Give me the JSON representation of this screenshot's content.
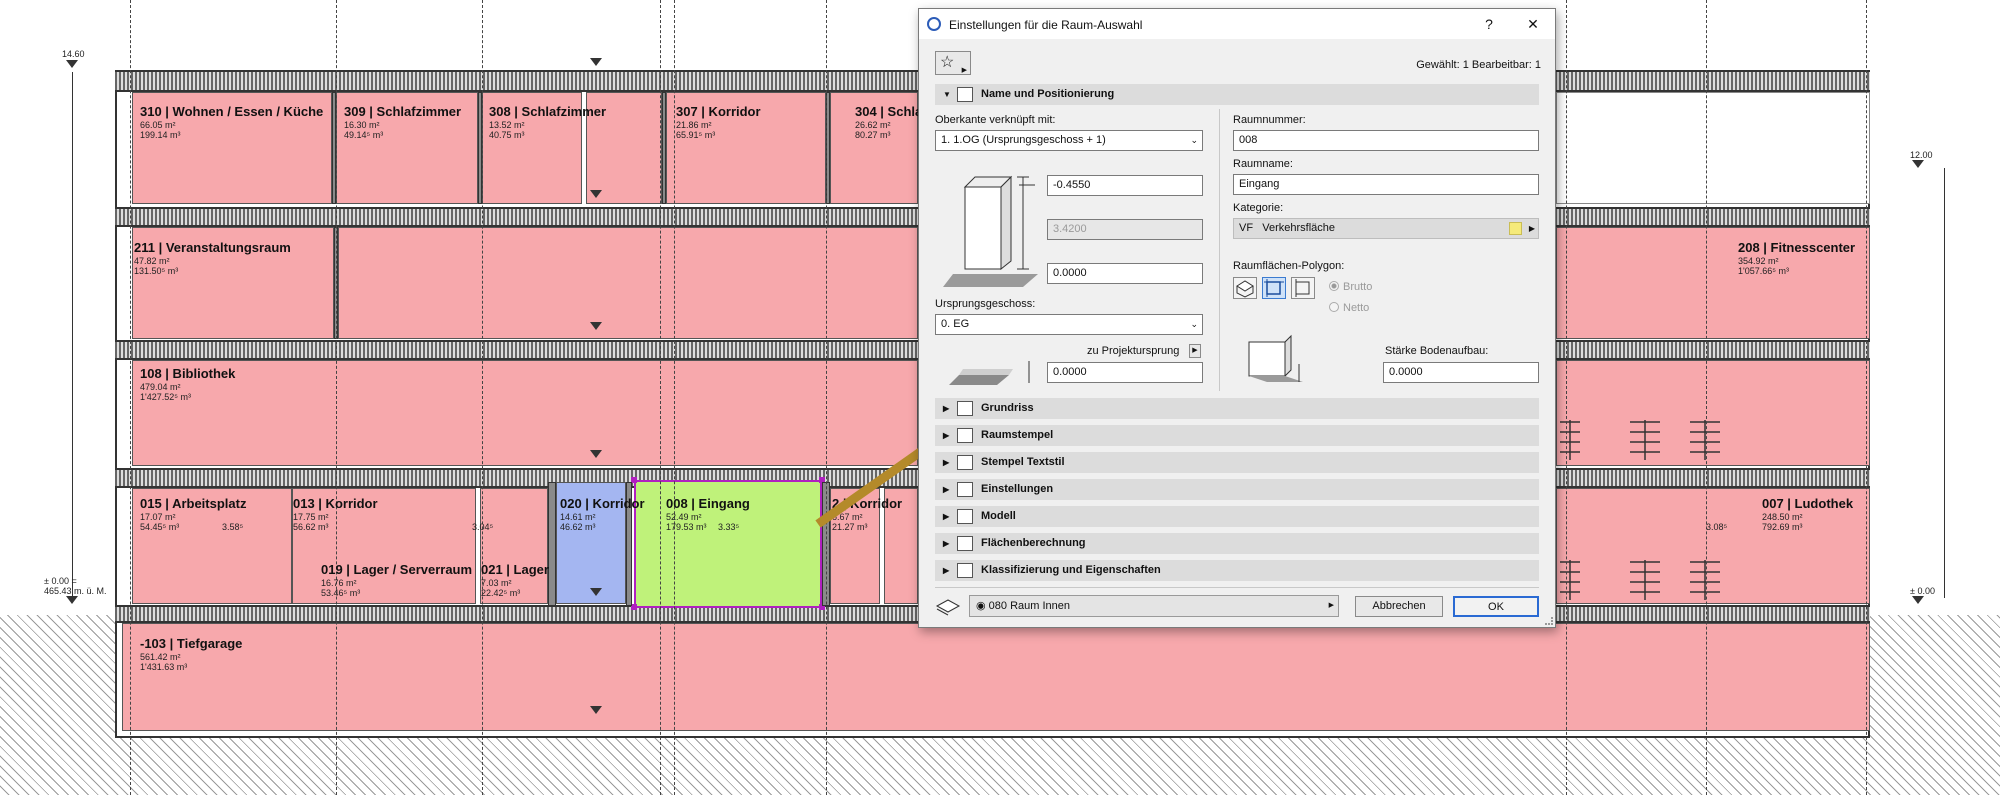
{
  "drawing": {
    "rooms": [
      {
        "id": "310",
        "label": "310 | Wohnen / Essen / Küche",
        "v1": "66.05 m²",
        "v2": "199.14 m³"
      },
      {
        "id": "309",
        "label": "309 | Schlafzimmer",
        "v1": "16.30 m²",
        "v2": "49.14⁵ m³"
      },
      {
        "id": "308",
        "label": "308 | Schlafzimmer",
        "v1": "13.52 m²",
        "v2": "40.75 m³"
      },
      {
        "id": "307",
        "label": "307 | Korridor",
        "v1": "21.86 m²",
        "v2": "65.91⁵ m³"
      },
      {
        "id": "304",
        "label": "304 | Schla",
        "v1": "26.62 m²",
        "v2": "80.27 m³"
      },
      {
        "id": "211",
        "label": "211 | Veranstaltungsraum",
        "v1": "47.82 m²",
        "v2": "131.50⁵ m³"
      },
      {
        "id": "208",
        "label": "208 | Fitnesscenter",
        "v1": "354.92 m²",
        "v2": "1'057.66⁵ m³"
      },
      {
        "id": "108",
        "label": "108 | Bibliothek",
        "v1": "479.04 m²",
        "v2": "1'427.52⁵ m³"
      },
      {
        "id": "015",
        "label": "015 | Arbeitsplatz",
        "v1": "17.07 m²",
        "v2": "54.45⁵ m³"
      },
      {
        "id": "013",
        "label": "013 | Korridor",
        "v1": "17.75 m²",
        "v2": "56.62 m³"
      },
      {
        "id": "019",
        "label": "019 | Lager / Serverraum",
        "v1": "16.76 m²",
        "v2": "53.46⁵ m³"
      },
      {
        "id": "021",
        "label": "021 | Lager",
        "v1": "7.03 m²",
        "v2": "22.42⁵ m³"
      },
      {
        "id": "020",
        "label": "020 | Korridor",
        "v1": "14.61 m²",
        "v2": "46.62 m³"
      },
      {
        "id": "008",
        "label": "008 | Eingang",
        "v1": "52.49 m²",
        "v2": "179.53 m³"
      },
      {
        "id": "012",
        "label": "2 | Korridor",
        "v1": "6.67 m²",
        "v2": "21.27 m³"
      },
      {
        "id": "007",
        "label": "007 | Ludothek",
        "v1": "248.50 m²",
        "v2": "792.69 m³"
      },
      {
        "id": "-103",
        "label": "-103 | Tiefgarage",
        "v1": "561.42 m²",
        "v2": "1'431.63 m³"
      }
    ],
    "dims": {
      "d015": "3.58⁵",
      "d013": "3.04⁵",
      "d008": "3.33⁵",
      "d007": "3.08⁵"
    },
    "levels": {
      "top_left": "14.60",
      "top_right": "12.00",
      "base_left_1": "± 0.00 =",
      "base_left_2": "465.43 m. ü. M.",
      "base_right": "± 0.00"
    }
  },
  "dialog": {
    "title": "Einstellungen für die Raum-Auswahl",
    "help": "?",
    "close": "✕",
    "selection_info": "Gewählt: 1 Bearbeitbar: 1",
    "section_main": "Name und Positionierung",
    "oberkante_label": "Oberkante verknüpft mit:",
    "oberkante_value": "1. 1.OG (Ursprungsgeschoss + 1)",
    "top_offset": "-0.4550",
    "height_value": "3.4200",
    "bottom_offset": "0.0000",
    "ursprung_label": "Ursprungsgeschoss:",
    "ursprung_value": "0. EG",
    "projekt_label": "zu Projektursprung",
    "projekt_value": "0.0000",
    "raumnummer_label": "Raumnummer:",
    "raumnummer_value": "008",
    "raumname_label": "Raumname:",
    "raumname_value": "Eingang",
    "kategorie_label": "Kategorie:",
    "kategorie_code": "VF",
    "kategorie_value": "Verkehrsfläche",
    "kategorie_color": "#f5ea7a",
    "polygon_label": "Raumflächen-Polygon:",
    "radio_brutto": "Brutto",
    "radio_netto": "Netto",
    "boden_label": "Stärke Bodenaufbau:",
    "boden_value": "0.0000",
    "sections": [
      "Grundriss",
      "Raumstempel",
      "Stempel Textstil",
      "Einstellungen",
      "Modell",
      "Flächenberechnung",
      "Klassifizierung und Eigenschaften"
    ],
    "view_value": "080 Raum Innen",
    "cancel": "Abbrechen",
    "ok": "OK"
  },
  "colors": {
    "room_red": "#f7a8ac",
    "room_blue": "#a4b6f1",
    "room_green": "#bff27a",
    "arrow": "#b48a2a"
  }
}
